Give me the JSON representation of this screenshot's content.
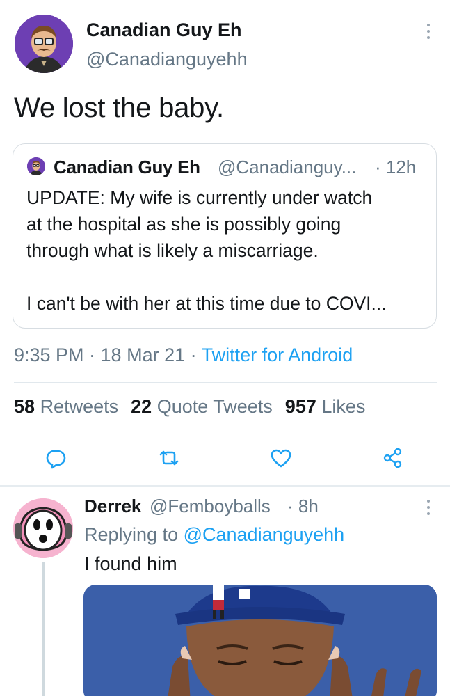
{
  "main_tweet": {
    "display_name": "Canadian Guy Eh",
    "handle": "@Canadianguyehh",
    "text": "We lost the baby.",
    "timestamp": "9:35 PM · 18 Mar 21 · ",
    "source": "Twitter for Android",
    "retweets_count": "58",
    "retweets_label": "Retweets",
    "quotes_count": "22",
    "quotes_label": "Quote Tweets",
    "likes_count": "957",
    "likes_label": "Likes"
  },
  "quoted_tweet": {
    "display_name": "Canadian Guy Eh",
    "handle": "@Canadianguy...",
    "time": "· 12h",
    "line1": "UPDATE: My wife is currently under watch",
    "line2": "at the hospital as she is possibly going",
    "line3": "through what is likely a miscarriage.",
    "line4": "I can't be with her at this time due to COVI..."
  },
  "reply": {
    "display_name": "Derrek",
    "handle": "@Femboyballs",
    "time": "· 8h",
    "replying_prefix": "Replying to ",
    "replying_to": "@Canadianguyehh",
    "text": "I found him"
  },
  "icons": {
    "reply": "reply-icon",
    "retweet": "retweet-icon",
    "like": "heart-icon",
    "share": "share-icon",
    "more": "more-vertical-icon"
  },
  "colors": {
    "link": "#1da1f2",
    "secondary_text": "#657786",
    "primary_text": "#14171a",
    "icon": "#1da1f2"
  }
}
